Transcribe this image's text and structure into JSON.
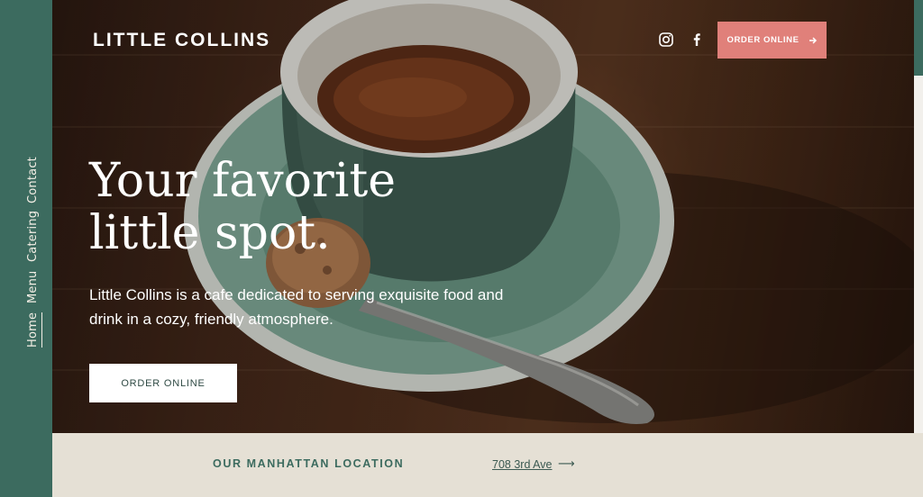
{
  "brand": {
    "name": "LITTLE COLLINS"
  },
  "side_nav": {
    "items": [
      {
        "label": "Contact",
        "active": false
      },
      {
        "label": "Catering",
        "active": false
      },
      {
        "label": "Menu",
        "active": false
      },
      {
        "label": "Home",
        "active": true
      }
    ]
  },
  "header": {
    "social": [
      "instagram-icon",
      "facebook-icon"
    ],
    "order_button": "ORDER ONLINE",
    "order_button_icon": "arrow-right-icon"
  },
  "hero": {
    "headline_line1": "Your favorite",
    "headline_line2": "little spot.",
    "subtext": "Little Collins is a cafe dedicated to serving exquisite food and drink in a cozy, friendly atmosphere.",
    "order_button": "ORDER ONLINE"
  },
  "location": {
    "title": "OUR MANHATTAN LOCATION",
    "address": "708 3rd Ave",
    "arrow": "⟶"
  },
  "colors": {
    "brand_green": "#3c6b5f",
    "accent_coral": "#e0807a",
    "band_beige": "#e5e0d5"
  }
}
